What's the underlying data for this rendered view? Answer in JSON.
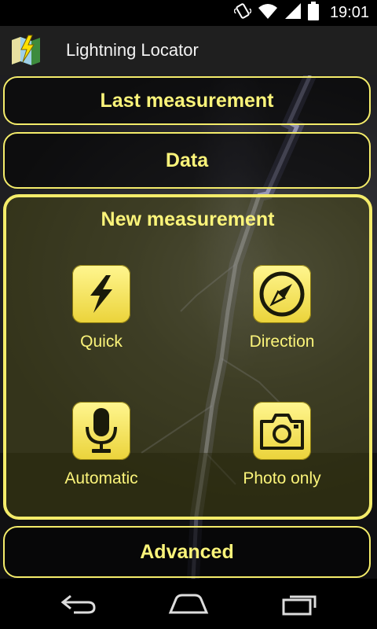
{
  "status_bar": {
    "time": "19:01",
    "icons": [
      "vibrate-icon",
      "wifi-icon",
      "signal-icon",
      "battery-icon"
    ]
  },
  "app": {
    "title": "Lightning Locator",
    "icon": "lightning-map-icon"
  },
  "menu": {
    "last_measurement": "Last measurement",
    "data": "Data",
    "advanced": "Advanced"
  },
  "new_measurement": {
    "title": "New measurement",
    "options": [
      {
        "label": "Quick",
        "icon": "lightning-bolt-icon"
      },
      {
        "label": "Direction",
        "icon": "compass-icon"
      },
      {
        "label": "Automatic",
        "icon": "microphone-icon"
      },
      {
        "label": "Photo only",
        "icon": "camera-icon"
      }
    ]
  },
  "nav": [
    "back-icon",
    "home-icon",
    "recent-apps-icon"
  ],
  "colors": {
    "accent": "#f4ec6a",
    "accent_text": "#fbf47a",
    "action_bar": "#1f1f1f"
  }
}
